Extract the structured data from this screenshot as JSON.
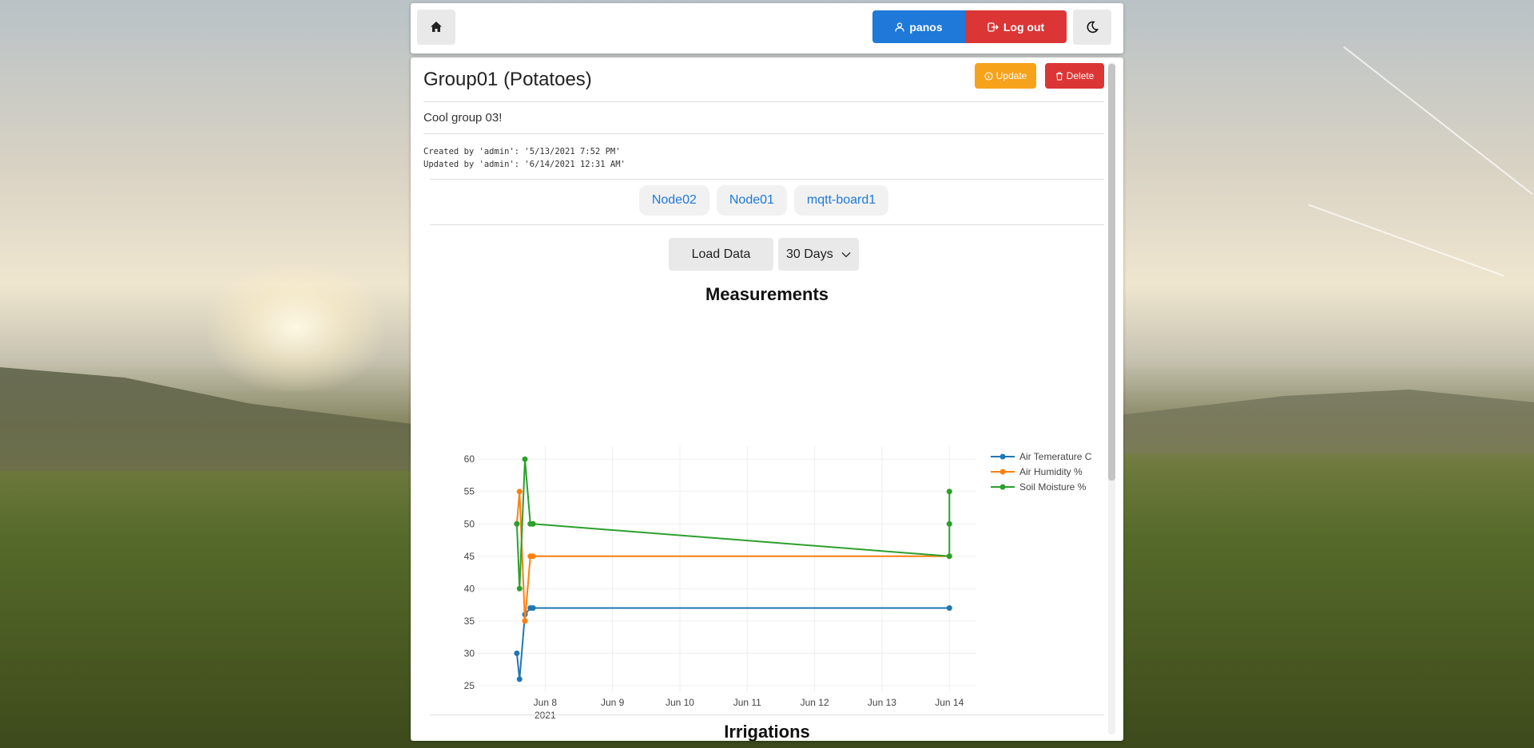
{
  "nav": {
    "user_label": "panos",
    "logout_label": "Log out"
  },
  "group": {
    "title": "Group01 (Potatoes)",
    "update_label": "Update",
    "delete_label": "Delete",
    "description": "Cool group 03!",
    "created": "Created by 'admin': '5/13/2021 7:52 PM'",
    "updated": "Updated by 'admin': '6/14/2021 12:31 AM'"
  },
  "nodes": [
    "Node02",
    "Node01",
    "mqtt-board1"
  ],
  "controls": {
    "load_label": "Load Data",
    "range_value": "30 Days"
  },
  "chart_title": "Measurements",
  "irrigations_title": "Irrigations",
  "chart_data": {
    "type": "line",
    "title": "Measurements",
    "xlabel": "",
    "ylabel": "",
    "x_tick_labels": [
      "Jun 8",
      "Jun 9",
      "Jun 10",
      "Jun 11",
      "Jun 12",
      "Jun 13",
      "Jun 14"
    ],
    "x_year_label": "2021",
    "y_ticks": [
      25,
      30,
      35,
      40,
      45,
      50,
      55,
      60
    ],
    "xlim_days": [
      7.0,
      14.4
    ],
    "ylim": [
      24,
      62
    ],
    "grid": true,
    "legend_position": "top-right",
    "series": [
      {
        "name": "Air Temerature C",
        "color": "#1f77b4",
        "points": [
          [
            7.58,
            30
          ],
          [
            7.62,
            26
          ],
          [
            7.7,
            36
          ],
          [
            7.78,
            37
          ],
          [
            7.82,
            37
          ],
          [
            14.0,
            37
          ]
        ]
      },
      {
        "name": "Air Humidity %",
        "color": "#ff7f0e",
        "points": [
          [
            7.58,
            50
          ],
          [
            7.62,
            55
          ],
          [
            7.7,
            35
          ],
          [
            7.78,
            45
          ],
          [
            7.82,
            45
          ],
          [
            14.0,
            45
          ]
        ]
      },
      {
        "name": "Soil Moisture %",
        "color": "#2ca02c",
        "points": [
          [
            7.58,
            50
          ],
          [
            7.62,
            40
          ],
          [
            7.7,
            60
          ],
          [
            7.78,
            50
          ],
          [
            7.82,
            50
          ],
          [
            14.0,
            45
          ],
          [
            14.0,
            50
          ],
          [
            14.0,
            55
          ]
        ]
      }
    ]
  }
}
